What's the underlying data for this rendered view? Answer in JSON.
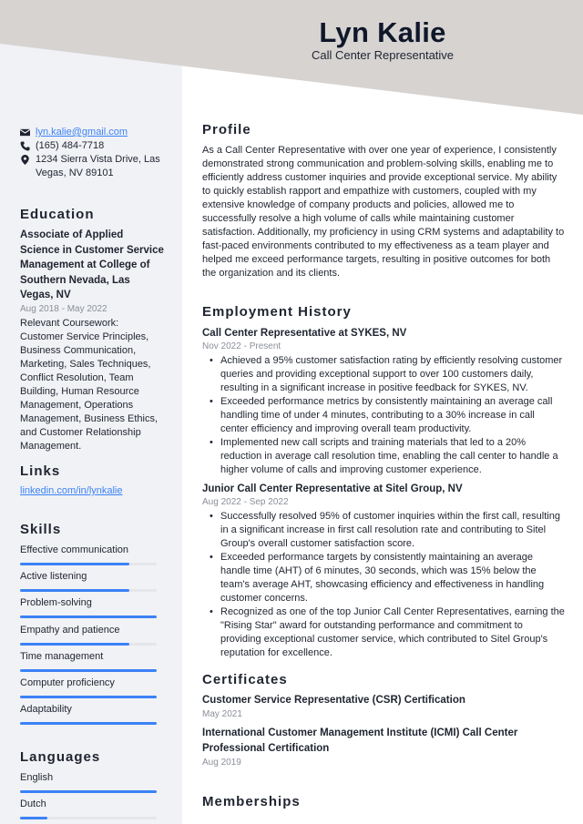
{
  "header": {
    "name": "Lyn Kalie",
    "title": "Call Center Representative",
    "band_color": "#d6d3d1"
  },
  "contact": {
    "email": "lyn.kalie@gmail.com",
    "phone": "(165) 484-7718",
    "address": "1234 Sierra Vista Drive, Las Vegas, NV 89101",
    "icons": [
      "envelope-icon",
      "phone-icon",
      "map-pin-icon"
    ]
  },
  "education": {
    "heading": "Education",
    "degree": "Associate of Applied Science in Customer Service Management at College of Southern Nevada, Las Vegas, NV",
    "dates": "Aug 2018 - May 2022",
    "coursework": "Relevant Coursework: Customer Service Principles, Business Communication, Marketing, Sales Techniques, Conflict Resolution, Team Building, Human Resource Management, Operations Management, Business Ethics, and Customer Relationship Management."
  },
  "links": {
    "heading": "Links",
    "items": [
      {
        "label": "linkedin.com/in/lynkalie"
      }
    ]
  },
  "skills": {
    "heading": "Skills",
    "accent": "#3b82f6",
    "items": [
      {
        "label": "Effective communication",
        "level": 0.8
      },
      {
        "label": "Active listening",
        "level": 0.8
      },
      {
        "label": "Problem-solving",
        "level": 1.0
      },
      {
        "label": "Empathy and patience",
        "level": 0.8
      },
      {
        "label": "Time management",
        "level": 1.0
      },
      {
        "label": "Computer proficiency",
        "level": 1.0
      },
      {
        "label": "Adaptability",
        "level": 1.0
      }
    ]
  },
  "languages": {
    "heading": "Languages",
    "items": [
      {
        "label": "English",
        "level": 1.0
      },
      {
        "label": "Dutch",
        "level": 0.2
      }
    ]
  },
  "profile": {
    "heading": "Profile",
    "text": "As a Call Center Representative with over one year of experience, I consistently demonstrated strong communication and problem-solving skills, enabling me to efficiently address customer inquiries and provide exceptional service. My ability to quickly establish rapport and empathize with customers, coupled with my extensive knowledge of company products and policies, allowed me to successfully resolve a high volume of calls while maintaining customer satisfaction. Additionally, my proficiency in using CRM systems and adaptability to fast-paced environments contributed to my effectiveness as a team player and helped me exceed performance targets, resulting in positive outcomes for both the organization and its clients."
  },
  "employment": {
    "heading": "Employment History",
    "jobs": [
      {
        "title": "Call Center Representative at SYKES, NV",
        "dates": "Nov 2022 - Present",
        "bullets": [
          "Achieved a 95% customer satisfaction rating by efficiently resolving customer queries and providing exceptional support to over 100 customers daily, resulting in a significant increase in positive feedback for SYKES, NV.",
          "Exceeded performance metrics by consistently maintaining an average call handling time of under 4 minutes, contributing to a 30% increase in call center efficiency and improving overall team productivity.",
          "Implemented new call scripts and training materials that led to a 20% reduction in average call resolution time, enabling the call center to handle a higher volume of calls and improving customer experience."
        ]
      },
      {
        "title": "Junior Call Center Representative at Sitel Group, NV",
        "dates": "Aug 2022 - Sep 2022",
        "bullets": [
          "Successfully resolved 95% of customer inquiries within the first call, resulting in a significant increase in first call resolution rate and contributing to Sitel Group's overall customer satisfaction score.",
          "Exceeded performance targets by consistently maintaining an average handle time (AHT) of 6 minutes, 30 seconds, which was 15% below the team's average AHT, showcasing efficiency and effectiveness in handling customer concerns.",
          "Recognized as one of the top Junior Call Center Representatives, earning the \"Rising Star\" award for outstanding performance and commitment to providing exceptional customer service, which contributed to Sitel Group's reputation for excellence."
        ]
      }
    ]
  },
  "certificates": {
    "heading": "Certificates",
    "items": [
      {
        "title": "Customer Service Representative (CSR) Certification",
        "date": "May 2021"
      },
      {
        "title": "International Customer Management Institute (ICMI) Call Center Professional Certification",
        "date": "Aug 2019"
      }
    ]
  },
  "memberships": {
    "heading": "Memberships"
  }
}
